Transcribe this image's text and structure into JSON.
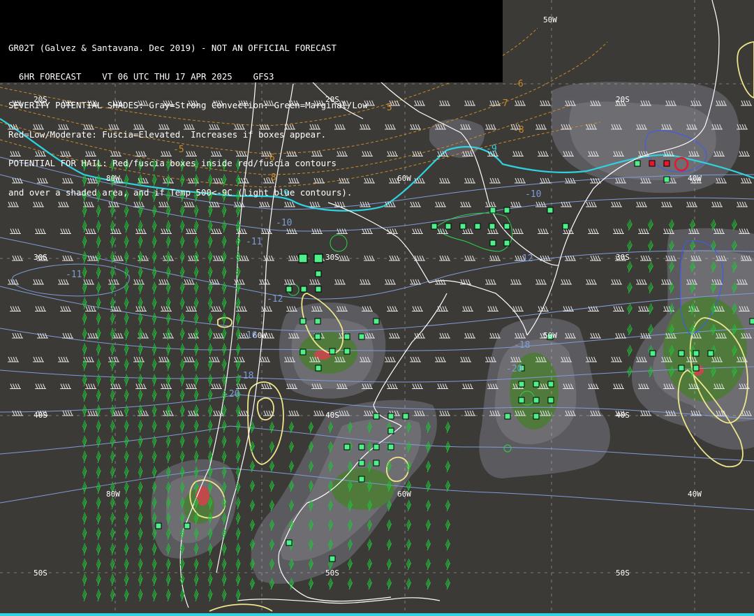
{
  "header": {
    "line1": "GR02T (Galvez & Santavana. Dec 2019) - NOT AN OFFICIAL FORECAST",
    "line2": "  6HR FORECAST    VT 06 UTC THU 17 APR 2025    GFS3",
    "line3": "SEVERITY POTENTIAL SHADES: Gray=Strong Convection: Green=Marginal/Low",
    "line4": "Red=Low/Moderate: Fuscia=Elevated. Increases if boxes appear.",
    "line5": "POTENTIAL FOR HAIL: Red/fuscia boxes inside red/fuscia contours",
    "line6": "and over a shaded area, and if Temp 500<-9C (light blue contours)."
  },
  "latlon_labels": {
    "lat_20s_left": "20S",
    "lat_20s_mid": "20S",
    "lat_20s_right": "20S",
    "lat_30s_left": "30S",
    "lat_30s_mid": "30S",
    "lat_30s_right": "30S",
    "lat_40s_left": "40S",
    "lat_40s_mid": "40S",
    "lat_40s_right": "40S",
    "lat_50s_left": "50S",
    "lat_50s_mid": "50S",
    "lat_50s_right": "50S",
    "lon_50w_top": "50W",
    "lon_80w_upper": "80W",
    "lon_60w_upper": "60W",
    "lon_40w_upper": "40W",
    "lon_60w_mid": "60W",
    "lon_50w_mid": "50W",
    "lon_80w_lower": "80W",
    "lon_60w_lower": "60W",
    "lon_40w_lower": "40W"
  },
  "contour_labels": {
    "t500_minus5_a": "-5",
    "t500_minus5_b": "-5",
    "t500_minus6_a": "-6",
    "t500_minus6_b": "-6",
    "t500_minus7": "-7",
    "t500_minus8_a": "-8",
    "t500_minus8_b": "-8",
    "t500_minus9_a": "-9",
    "t500_minus9_b": "-9",
    "t500_minus10_a": "-10",
    "t500_minus10_b": "-10",
    "t500_minus11_a": "-11",
    "t500_minus11_b": "-11",
    "t500_minus12_a": "-12",
    "t500_minus12_b": "-12",
    "t500_minus16": "-16",
    "t500_minus18_a": "-18",
    "t500_minus18_b": "-18",
    "t500_minus20_a": "-20",
    "t500_minus20_b": "-20"
  },
  "colors": {
    "background": "#3c3a36",
    "shade_gray_dark": "#5b5a5e",
    "shade_gray_mid": "#6e6d72",
    "shade_gray_light": "#84838a",
    "shade_green": "#4f7a3c",
    "shade_red": "#c04a4a",
    "box_green": "#4ef08a",
    "box_red": "#e8182a",
    "hail_contour_yellow": "#eee68a",
    "temp_minus9_cyan": "#2fd3e0",
    "temp_contour_blue": "#7f9cd8",
    "temp_contour_orange": "#c98a2a",
    "wind_barb_white": "#e6e6e6",
    "wind_barb_green": "#22c23a",
    "coastline": "#ffffff"
  }
}
